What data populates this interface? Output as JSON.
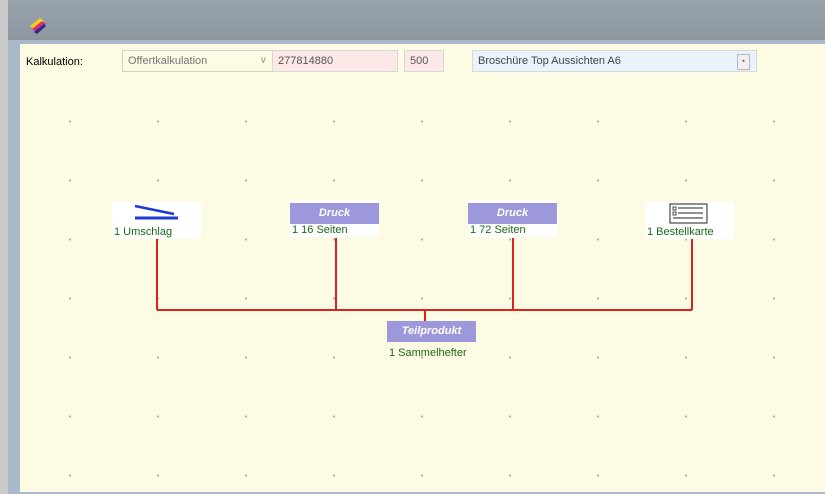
{
  "toolbar": {
    "kalkulation_label": "Kalkulation:",
    "calc_type": "Offertkalkulation",
    "calc_number": "277814880",
    "quantity": "500",
    "product_name": "Broschüre Top Aussichten A6"
  },
  "nodes": {
    "umschlag": {
      "caption": "1 Umschlag",
      "icon": "cover-icon"
    },
    "seiten16": {
      "badge": "Druck",
      "caption": "1 16 Seiten"
    },
    "seiten72": {
      "badge": "Druck",
      "caption": "1 72 Seiten"
    },
    "bestellkarte": {
      "caption": "1 Bestellkarte",
      "icon": "card-icon"
    },
    "teilprodukt": {
      "badge": "Teilprodukt",
      "caption": "1 Sammelhefter"
    }
  },
  "colors": {
    "canvas": "#fdfbe4",
    "link": "#e0201e",
    "badge": "#9d97db",
    "caption": "#1a6a1a"
  }
}
